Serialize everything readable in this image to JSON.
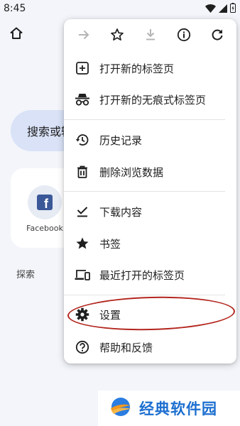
{
  "status_bar": {
    "time": "8:45"
  },
  "page": {
    "search_placeholder": "搜索或输入网址",
    "shortcut": {
      "label": "Facebook",
      "logo_letter": "f"
    },
    "explore_label": "探索"
  },
  "menu": {
    "toolbar": [
      {
        "name": "forward",
        "icon": "arrow-right-icon",
        "enabled": false
      },
      {
        "name": "bookmark",
        "icon": "star-outline-icon",
        "enabled": true
      },
      {
        "name": "download",
        "icon": "download-icon",
        "enabled": false
      },
      {
        "name": "page-info",
        "icon": "info-icon",
        "enabled": true
      },
      {
        "name": "reload",
        "icon": "reload-icon",
        "enabled": true
      }
    ],
    "items": [
      {
        "label": "打开新的标签页",
        "icon": "add-box-icon"
      },
      {
        "label": "打开新的无痕式标签页",
        "icon": "incognito-icon"
      },
      {
        "label": "历史记录",
        "icon": "history-icon"
      },
      {
        "label": "删除浏览数据",
        "icon": "trash-icon"
      },
      {
        "label": "下载内容",
        "icon": "download-done-icon"
      },
      {
        "label": "书签",
        "icon": "star-filled-icon"
      },
      {
        "label": "最近打开的标签页",
        "icon": "devices-icon"
      },
      {
        "label": "设置",
        "icon": "gear-icon"
      },
      {
        "label": "帮助和反馈",
        "icon": "help-icon"
      }
    ]
  },
  "annotation": {
    "highlighted_item": "设置",
    "color": "#b3261e"
  },
  "watermark": {
    "text": "经典软件园"
  },
  "colors": {
    "background": "#f3f5fa",
    "search_box": "#d9e2f7",
    "facebook_blue": "#3b5998",
    "watermark_blue": "#1d6fd0"
  }
}
